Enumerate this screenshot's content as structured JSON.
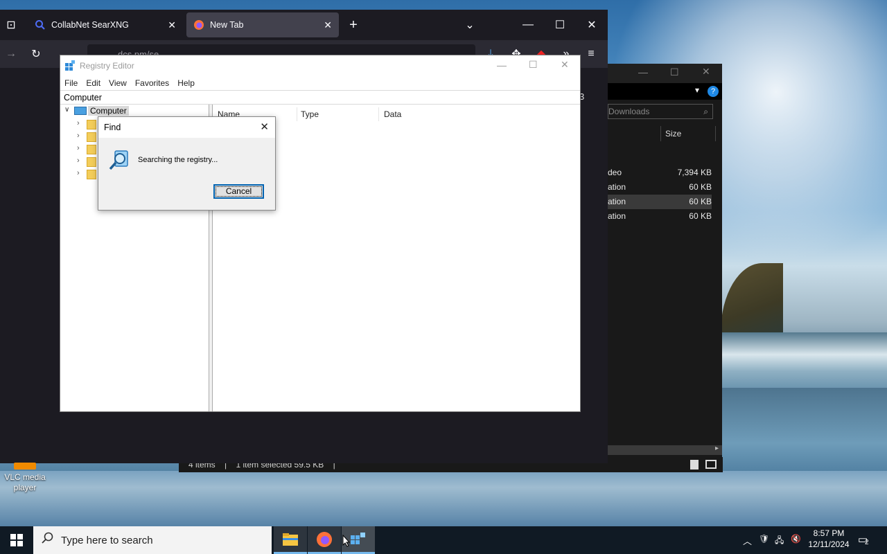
{
  "browser": {
    "tabs": [
      {
        "label": "CollabNet SearXNG",
        "icon": "search-icon"
      },
      {
        "label": "New Tab",
        "icon": "firefox-icon",
        "active": true
      }
    ],
    "url_text": "dcs.pm/se"
  },
  "explorer": {
    "search_placeholder": "Downloads",
    "size_header": "Size",
    "rows": [
      {
        "name": "deo",
        "size": "7,394 KB"
      },
      {
        "name": "ation",
        "size": "60 KB"
      },
      {
        "name": "ation",
        "size": "60 KB",
        "selected": true
      },
      {
        "name": "ation",
        "size": "60 KB"
      }
    ],
    "status_items": "4 items",
    "status_selected": "1 item selected  59.5 KB",
    "side_digit": "3"
  },
  "registry": {
    "title": "Registry Editor",
    "menu": [
      "File",
      "Edit",
      "View",
      "Favorites",
      "Help"
    ],
    "address": "Computer",
    "tree_root": "Computer",
    "columns": [
      "Name",
      "Type",
      "Data"
    ]
  },
  "find_dialog": {
    "title": "Find",
    "message": "Searching the registry...",
    "cancel_label": "Cancel"
  },
  "desktop": {
    "icon_label_line1": "VLC media",
    "icon_label_line2": "player"
  },
  "taskbar": {
    "search_placeholder": "Type here to search",
    "time": "8:57 PM",
    "date": "12/11/2024",
    "notification_count": "2"
  }
}
